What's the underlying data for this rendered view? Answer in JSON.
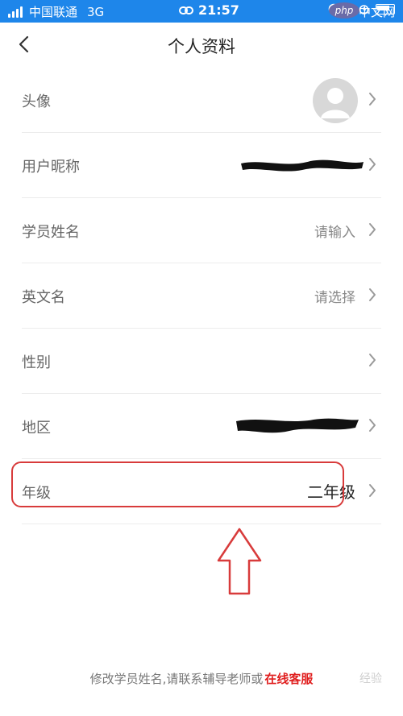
{
  "status_bar": {
    "carrier": "中国联通",
    "network": "3G",
    "time": "21:57"
  },
  "header": {
    "title": "个人资料"
  },
  "rows": [
    {
      "label": "头像",
      "value": ""
    },
    {
      "label": "用户昵称",
      "value": ""
    },
    {
      "label": "学员姓名",
      "value": "请输入"
    },
    {
      "label": "英文名",
      "value": "请选择"
    },
    {
      "label": "性别",
      "value": ""
    },
    {
      "label": "地区",
      "value": ""
    },
    {
      "label": "年级",
      "value": "二年级"
    }
  ],
  "footer": {
    "text": "修改学员姓名,请联系辅导老师或",
    "link": "在线客服"
  },
  "watermark": {
    "brand": "php",
    "cn": "中文网",
    "bottom": "经验"
  },
  "colors": {
    "status_bar": "#1e86ea",
    "highlight": "#d83b3b",
    "link": "#e01f1f"
  }
}
